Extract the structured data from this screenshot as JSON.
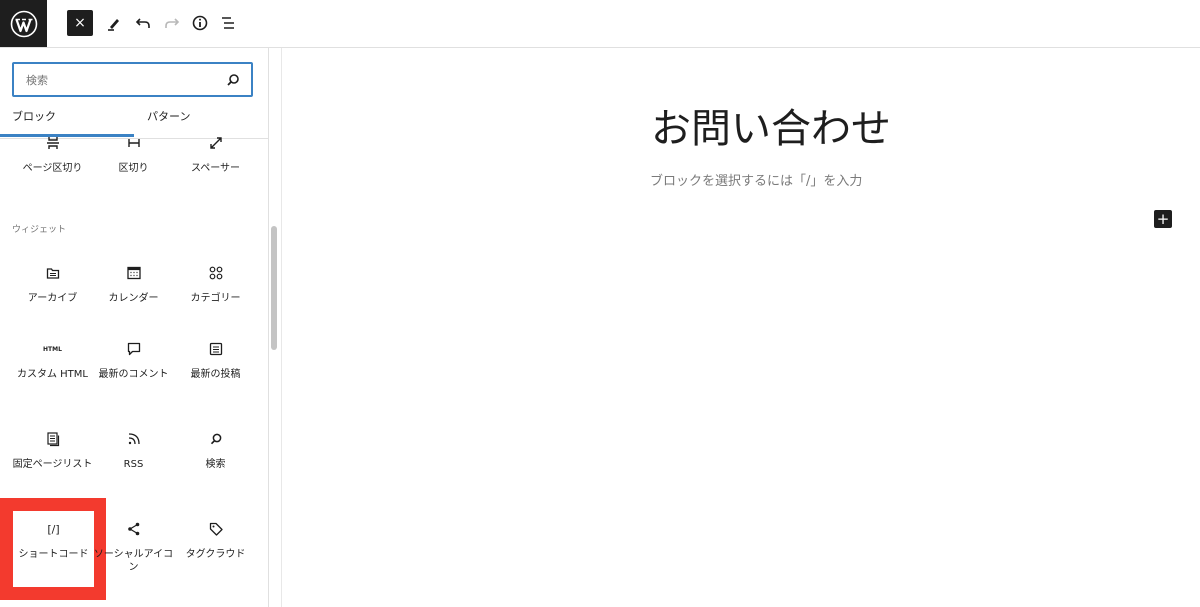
{
  "toolbar": {
    "close_label": "×"
  },
  "search": {
    "placeholder": "検索"
  },
  "tabs": [
    {
      "label": "ブロック",
      "active": true
    },
    {
      "label": "パターン",
      "active": false
    }
  ],
  "blocks_top": [
    {
      "label": "ページ区切り",
      "icon": "page-break-icon"
    },
    {
      "label": "区切り",
      "icon": "separator-icon"
    },
    {
      "label": "スペーサー",
      "icon": "spacer-icon"
    }
  ],
  "widgets": {
    "section_title": "ウィジェット",
    "items": [
      {
        "label": "アーカイブ",
        "icon": "archive-icon"
      },
      {
        "label": "カレンダー",
        "icon": "calendar-icon"
      },
      {
        "label": "カテゴリー",
        "icon": "categories-icon"
      },
      {
        "label": "カスタム HTML",
        "icon": "html-icon",
        "icon_text": "HTML"
      },
      {
        "label": "最新のコメント",
        "icon": "comment-icon"
      },
      {
        "label": "最新の投稿",
        "icon": "latest-posts-icon"
      },
      {
        "label": "固定ページリスト",
        "icon": "page-list-icon"
      },
      {
        "label": "RSS",
        "icon": "rss-icon"
      },
      {
        "label": "検索",
        "icon": "search-block-icon"
      },
      {
        "label": "ショートコード",
        "icon": "shortcode-icon",
        "icon_text": "[/]"
      },
      {
        "label": "ソーシャルアイコン",
        "icon": "share-icon"
      },
      {
        "label": "タグクラウド",
        "icon": "tag-icon"
      }
    ]
  },
  "editor": {
    "title": "お問い合わせ",
    "placeholder": "ブロックを選択するには「/」を入力",
    "add_label": "+"
  },
  "colors": {
    "accent": "#3b82c4",
    "highlight": "#f33a2e",
    "dark": "#1e1e1e"
  }
}
